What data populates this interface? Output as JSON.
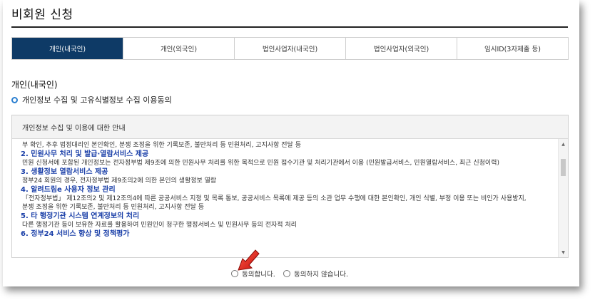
{
  "page": {
    "title": "비회원 신청"
  },
  "tabs": [
    {
      "label": "개인(내국인)",
      "active": true
    },
    {
      "label": "개인(외국인)",
      "active": false
    },
    {
      "label": "법인사업자(내국인)",
      "active": false
    },
    {
      "label": "법인사업자(외국인)",
      "active": false
    },
    {
      "label": "임시ID(3자제출 등)",
      "active": false
    }
  ],
  "section": {
    "heading": "개인(내국인)",
    "sub_heading": "개인정보 수집 및 고유식별정보 수집 이용동의"
  },
  "notice": {
    "header": "개인정보 수집 및 이용에 대한 안내",
    "clipped_top": "... ... ... ... ...",
    "lines": [
      {
        "type": "text",
        "text": "부 확인, 추후 법정대리인 본인확인, 분쟁 조정을 위한 기록보존, 불만처리 등 민원처리, 고지사항 전달 등"
      },
      {
        "type": "head",
        "text": "2. 민원사무 처리 및 발급·열람서비스 제공"
      },
      {
        "type": "text",
        "text": "민원 신청서에 포함된 개인정보는 전자정부법 제9조에 의한 민원사무 처리를 위한 목적으로 민원 접수기관 및 처리기관에서 이용 (민원발급서비스, 민원열람서비스, 최근 신청이력)"
      },
      {
        "type": "head",
        "text": "3. 생활정보 열람서비스 제공"
      },
      {
        "type": "text",
        "text": "정부24 회원의 경우, 전자정부법 제9조의2에 의한 본인의 생활정보 열람"
      },
      {
        "type": "head",
        "text": "4. 알려드림e 사용자 정보 관리"
      },
      {
        "type": "text",
        "text": "「전자정부법」 제12조의2 및 제12조의4에 따른 공공서비스 지정 및 목록 통보, 공공서비스 목록에 제공 등의 소관 업무 수행에 대한 본인확인, 개인 식별, 부정 이용 또는 비인가 사용방지,"
      },
      {
        "type": "text",
        "text": "분쟁 조정을 위한 기록보존, 불만처리 등 민원처리, 고지사항 전달 등"
      },
      {
        "type": "head",
        "text": "5. 타 행정기관 시스템 연계정보의 처리"
      },
      {
        "type": "text",
        "text": "다른 행정기관 등이 보유한 자료를 활용하여 민원인이 청구한 행정서비스 및 민원사무 등의 전자적 처리"
      },
      {
        "type": "head",
        "text": "6. 정부24 서비스 향상 및 정책평가"
      }
    ]
  },
  "consent": {
    "agree_label": "동의합니다.",
    "disagree_label": "동의하지 않습니다."
  },
  "icons": {
    "scroll_up": "triangle-up-icon",
    "scroll_down": "triangle-down-icon",
    "pointer": "red-arrow-icon"
  },
  "colors": {
    "active_tab_bg": "#0e3a66",
    "heading_blue": "#1a3fa8",
    "bullet_blue": "#2a7fd0",
    "arrow_red": "#e0201a"
  }
}
